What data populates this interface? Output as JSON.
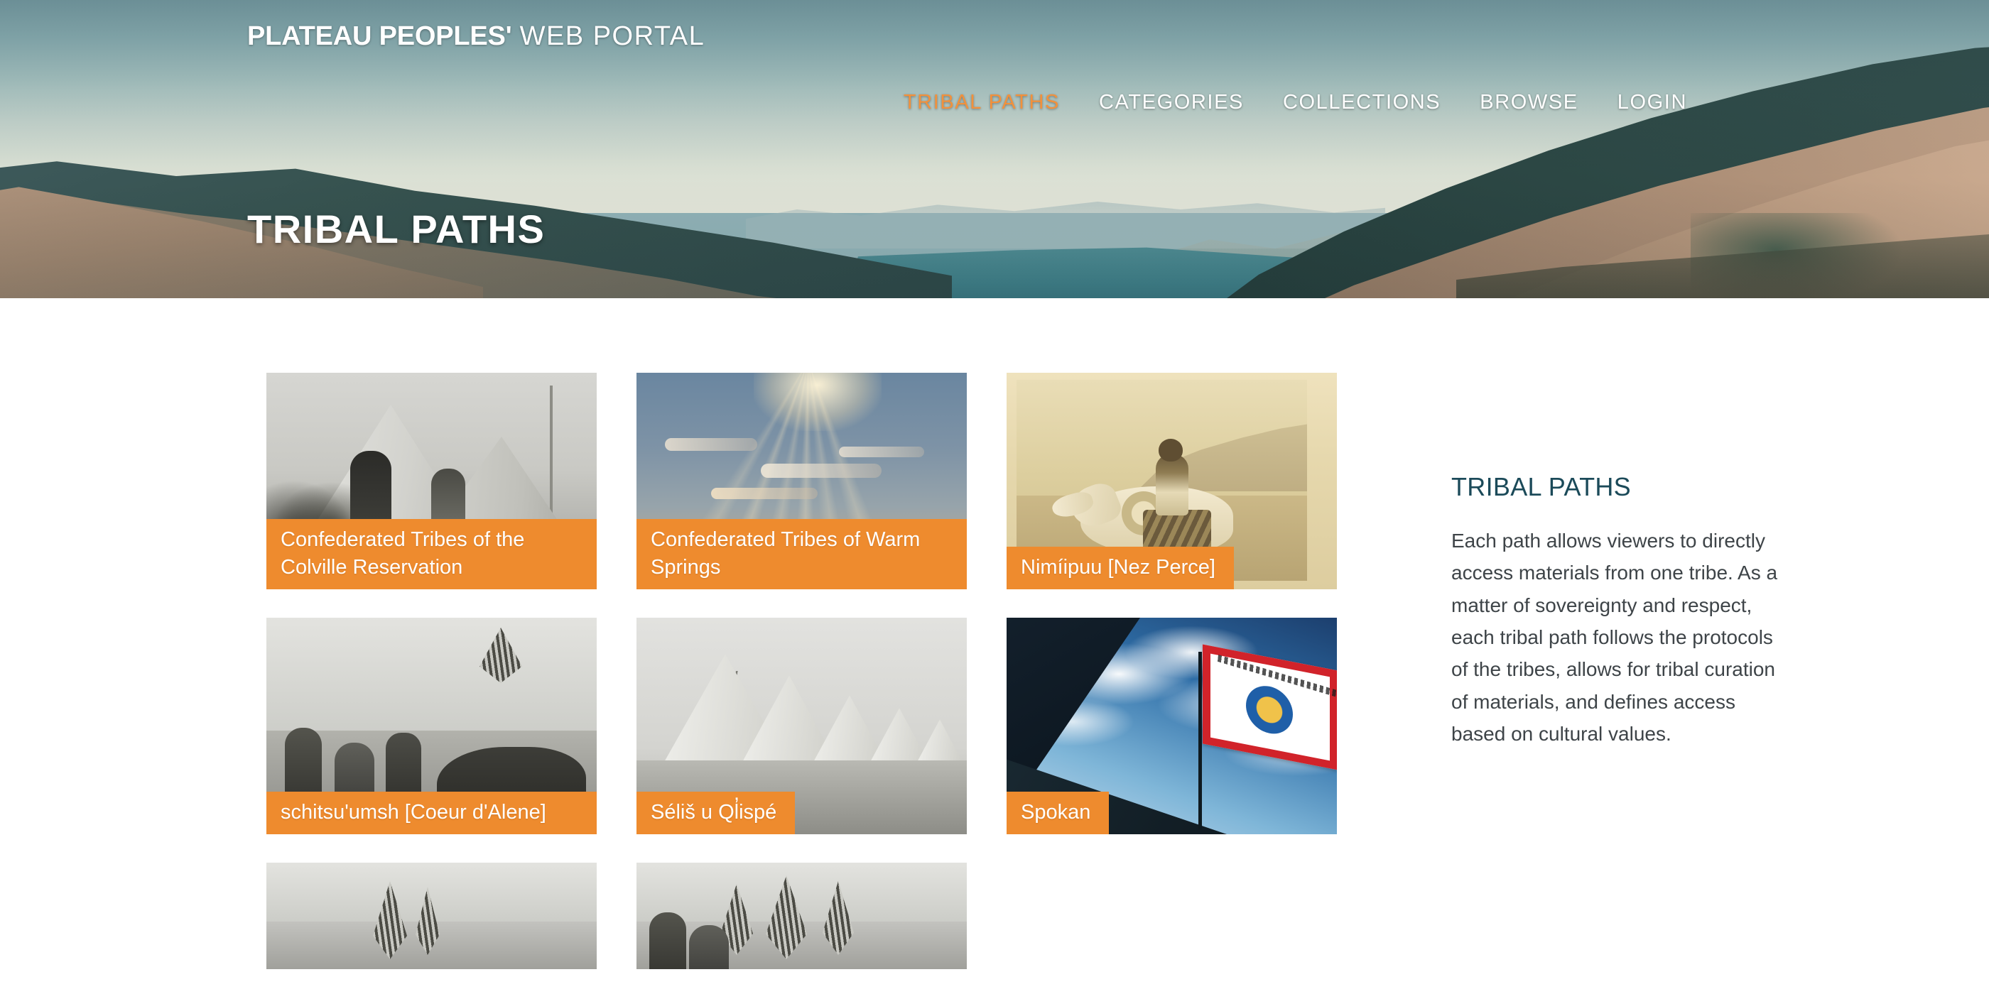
{
  "site": {
    "logo_bold": "PLATEAU PEOPLES'",
    "logo_light": "WEB PORTAL"
  },
  "nav": {
    "items": [
      {
        "label": "TRIBAL PATHS",
        "active": true
      },
      {
        "label": "CATEGORIES",
        "active": false
      },
      {
        "label": "COLLECTIONS",
        "active": false
      },
      {
        "label": "BROWSE",
        "active": false
      },
      {
        "label": "LOGIN",
        "active": false
      }
    ]
  },
  "hero": {
    "page_title": "TRIBAL PATHS"
  },
  "tribal_paths": {
    "cards": [
      {
        "label": "Confederated Tribes of the Colville Reservation",
        "image": "bw-photo-tipi-with-two-figures"
      },
      {
        "label": "Confederated Tribes of Warm Springs",
        "image": "sunset-sky-with-sun-rays"
      },
      {
        "label": "Nimíipuu [Nez Perce]",
        "image": "sepia-photo-rider-on-white-horse"
      },
      {
        "label": "schitsu'umsh [Coeur d'Alene]",
        "image": "bw-photo-group-with-horse"
      },
      {
        "label": "Séliš u Ql̓ispé",
        "image": "bw-photo-tipi-village"
      },
      {
        "label": "Spokan",
        "image": "spokane-tribe-of-indians-flag"
      },
      {
        "label": "",
        "image": "bw-photo-antlers-partial"
      },
      {
        "label": "",
        "image": "bw-photo-group-headdresses-partial"
      }
    ]
  },
  "sidebar": {
    "heading": "TRIBAL PATHS",
    "body": "Each path allows viewers to directly access materials from one tribe. As a matter of sovereignty and respect, each tribal path follows the protocols of the tribes, allows for tribal curation of materials, and defines access based on cultural values."
  },
  "colors": {
    "accent_orange": "#ee8b2e",
    "nav_active": "#f2913c",
    "heading_teal": "#1b4a59",
    "body_text": "#3e4448",
    "page_bg": "#ffffff"
  }
}
